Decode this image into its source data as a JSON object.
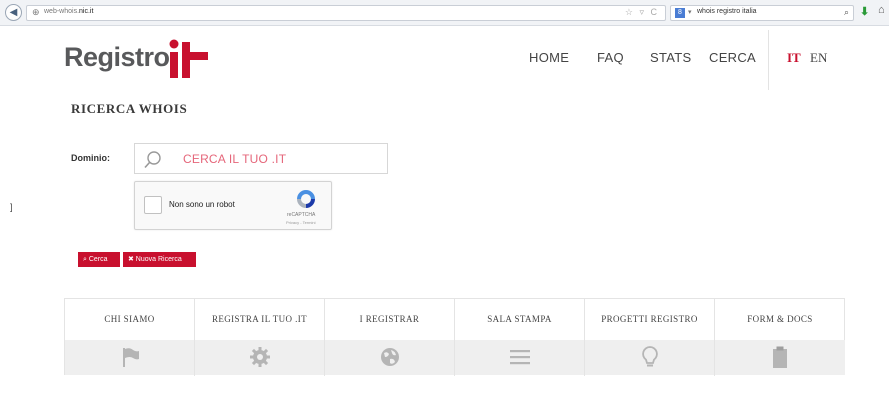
{
  "browser": {
    "url_prefix": "web-whois.",
    "url_domain": "nic.it",
    "search_query": "whois registro italia"
  },
  "logo": {
    "text": "Registro",
    "mark": ".it",
    "colors": {
      "text": "#58595b",
      "accent": "#c8102e"
    }
  },
  "nav": {
    "home": "HOME",
    "faq": "FAQ",
    "stats": "STATS",
    "cerca": "CERCA",
    "lang_it": "IT",
    "lang_en": "EN"
  },
  "page": {
    "title": "RICERCA WHOIS"
  },
  "form": {
    "dominio_label": "Dominio:",
    "dominio_placeholder": "CERCA IL TUO .IT",
    "captcha_label": "Non sono un robot",
    "captcha_brand": "reCAPTCHA",
    "captcha_links": "Privacy - Termini",
    "btn_cerca": "⌕ Cerca",
    "btn_nuova": "✖ Nuova Ricerca"
  },
  "left_mark": "]",
  "menu": {
    "items": [
      {
        "label": "CHI SIAMO",
        "icon": "flag-icon"
      },
      {
        "label": "REGISTRA IL TUO .IT",
        "icon": "gear-icon"
      },
      {
        "label": "I REGISTRAR",
        "icon": "globe-icon"
      },
      {
        "label": "SALA STAMPA",
        "icon": "menu-lines-icon"
      },
      {
        "label": "PROGETTI REGISTRO",
        "icon": "lightbulb-icon"
      },
      {
        "label": "FORM & DOCS",
        "icon": "clipboard-icon"
      }
    ]
  },
  "colors": {
    "accent": "#c8102e",
    "placeholder": "#e5667a",
    "icon": "#b5b5b5"
  }
}
